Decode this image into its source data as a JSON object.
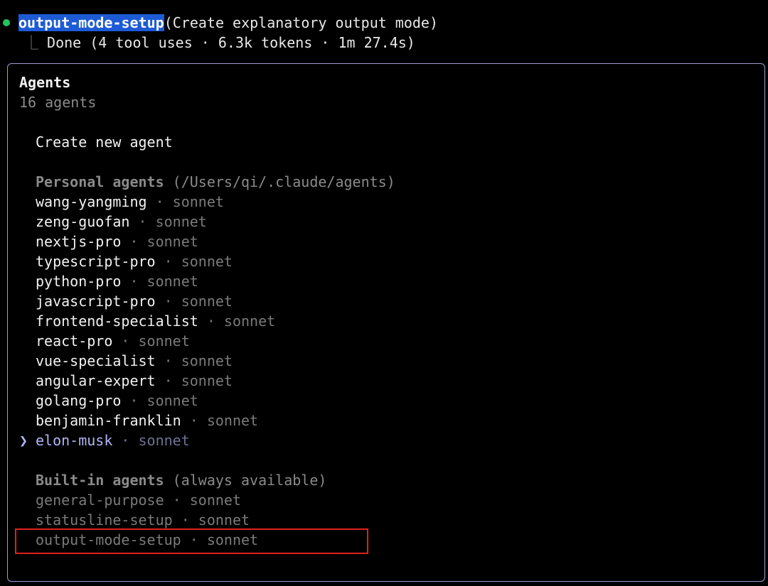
{
  "colors": {
    "background": "#000000",
    "status_dot": "#22c55e",
    "highlight_bg": "#1d5bd6",
    "panel_border": "#9c9cd4",
    "selected_text": "#b3b4f5",
    "annotation_box": "#e02020"
  },
  "task": {
    "name": "output-mode-setup",
    "description": "(Create explanatory output mode)",
    "tree_glyph": "⎿",
    "result": "Done (4 tool uses · 6.3k tokens · 1m 27.4s)"
  },
  "panel": {
    "title": "Agents",
    "count": "16 agents",
    "create_label": "Create new agent",
    "personal": {
      "heading": "Personal agents",
      "path": "(/Users/qi/.claude/agents)",
      "items": [
        {
          "name": "wang-yangming",
          "sep": " · ",
          "model": "sonnet"
        },
        {
          "name": "zeng-guofan",
          "sep": " · ",
          "model": "sonnet"
        },
        {
          "name": "nextjs-pro",
          "sep": " · ",
          "model": "sonnet"
        },
        {
          "name": "typescript-pro",
          "sep": " · ",
          "model": "sonnet"
        },
        {
          "name": "python-pro",
          "sep": " · ",
          "model": "sonnet"
        },
        {
          "name": "javascript-pro",
          "sep": " · ",
          "model": "sonnet"
        },
        {
          "name": "frontend-specialist",
          "sep": " · ",
          "model": "sonnet"
        },
        {
          "name": "react-pro",
          "sep": " · ",
          "model": "sonnet"
        },
        {
          "name": "vue-specialist",
          "sep": " · ",
          "model": "sonnet"
        },
        {
          "name": "angular-expert",
          "sep": " · ",
          "model": "sonnet"
        },
        {
          "name": "golang-pro",
          "sep": " · ",
          "model": "sonnet"
        },
        {
          "name": "benjamin-franklin",
          "sep": " · ",
          "model": "sonnet"
        },
        {
          "name": "elon-musk",
          "sep": " · ",
          "model": "sonnet",
          "pointer": "❯"
        }
      ]
    },
    "builtin": {
      "heading": "Built-in agents",
      "note": "(always available)",
      "items": [
        {
          "name": "general-purpose",
          "sep": " · ",
          "model": "sonnet"
        },
        {
          "name": "statusline-setup",
          "sep": " · ",
          "model": "sonnet"
        },
        {
          "name": "output-mode-setup",
          "sep": " · ",
          "model": "sonnet"
        }
      ]
    }
  }
}
